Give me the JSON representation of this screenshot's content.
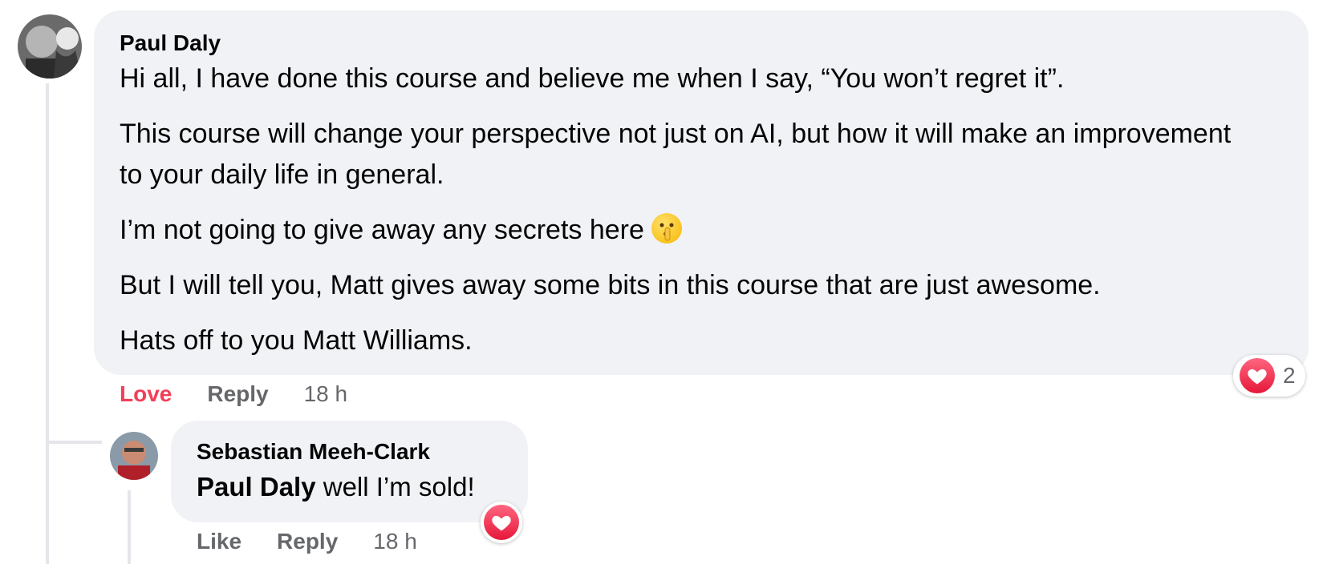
{
  "comment": {
    "author": "Paul Daly",
    "paragraphs": [
      "Hi all, I have done this course and believe me when I say, “You won’t regret it”.",
      "This course will change your perspective not just on AI, but how it will make an improvement to your daily life in general.",
      "I’m not going to give away any secrets here",
      "But I will tell you, Matt gives away some bits in this course that are just awesome.",
      "Hats off to you Matt Williams."
    ],
    "emoji": "shushing-face-icon",
    "actions": {
      "reaction": "Love",
      "reply": "Reply",
      "time": "18 h"
    },
    "reaction_count": "2"
  },
  "reply": {
    "author": "Sebastian Meeh-Clark",
    "mention": "Paul Daly",
    "text": " well I’m sold!",
    "actions": {
      "reaction": "Like",
      "reply": "Reply",
      "time": "18 h"
    }
  },
  "colors": {
    "bubble": "#f0f2f5",
    "love": "#f33e58",
    "meta": "#65676b",
    "thread": "#e4e6eb"
  }
}
